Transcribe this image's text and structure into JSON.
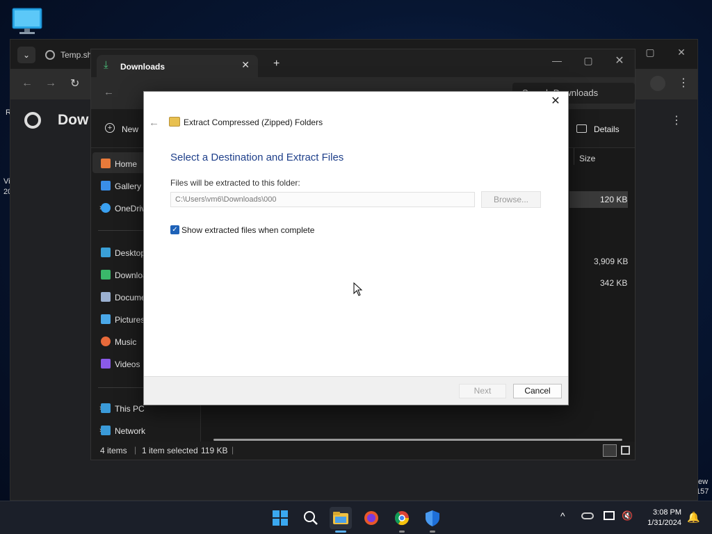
{
  "desktop": {
    "edge_text_left_1": "R",
    "edge_text_left_2": "Vi",
    "edge_text_left_3": "20",
    "edge_text_right_1": "ew",
    "edge_text_right_2": "157"
  },
  "chrome": {
    "tab_label": "Temp.sh",
    "page_heading": "Dow"
  },
  "explorer": {
    "tab_label": "Downloads",
    "search_placeholder": "Search Downloads",
    "cmd_new": "New",
    "cmd_details": "Details",
    "column_size": "Size",
    "sizes": [
      "120 KB",
      "3,909 KB",
      "342 KB"
    ],
    "sidebar": [
      {
        "label": "Home",
        "color": "#e87a3a"
      },
      {
        "label": "Gallery",
        "color": "#3a8ee8"
      },
      {
        "label": "OneDrive",
        "color": "#3aa0f0"
      },
      {
        "label": "Desktop",
        "color": "#3aa0d8"
      },
      {
        "label": "Downloads",
        "color": "#3ab86a"
      },
      {
        "label": "Documents",
        "color": "#9ab0d0"
      },
      {
        "label": "Pictures",
        "color": "#4aa8e8"
      },
      {
        "label": "Music",
        "color": "#e86a3a"
      },
      {
        "label": "Videos",
        "color": "#8a5ae8"
      },
      {
        "label": "This PC",
        "color": "#3a9ad8"
      },
      {
        "label": "Network",
        "color": "#3a9ad8"
      }
    ],
    "status": {
      "items": "4 items",
      "selected": "1 item selected",
      "size": "119 KB"
    }
  },
  "dialog": {
    "title": "Extract Compressed (Zipped) Folders",
    "heading": "Select a Destination and Extract Files",
    "folder_label": "Files will be extracted to this folder:",
    "folder_value": "C:\\Users\\vm6\\Downloads\\000",
    "browse_label": "Browse...",
    "checkbox_label": "Show extracted files when complete",
    "checkbox_checked": true,
    "next_label": "Next",
    "cancel_label": "Cancel",
    "close_glyph": "✕"
  },
  "taskbar": {
    "time": "3:08 PM",
    "date": "1/31/2024"
  }
}
